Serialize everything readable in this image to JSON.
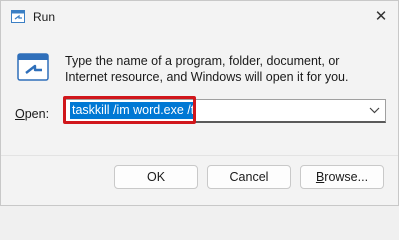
{
  "window": {
    "title": "Run",
    "close_symbol": "✕"
  },
  "description": "Type the name of a program, folder, document, or Internet resource, and Windows will open it for you.",
  "open_field": {
    "label_underlined": "O",
    "label_rest": "pen:",
    "value": "taskkill /im word.exe /t",
    "highlight_color": "#d0161b",
    "selection_color": "#0078d4"
  },
  "buttons": {
    "ok": "OK",
    "cancel": "Cancel",
    "browse_underlined": "B",
    "browse_rest": "rowse..."
  },
  "icons": [
    "run-icon",
    "run-dialog-icon",
    "close-icon",
    "chevron-down-icon"
  ]
}
